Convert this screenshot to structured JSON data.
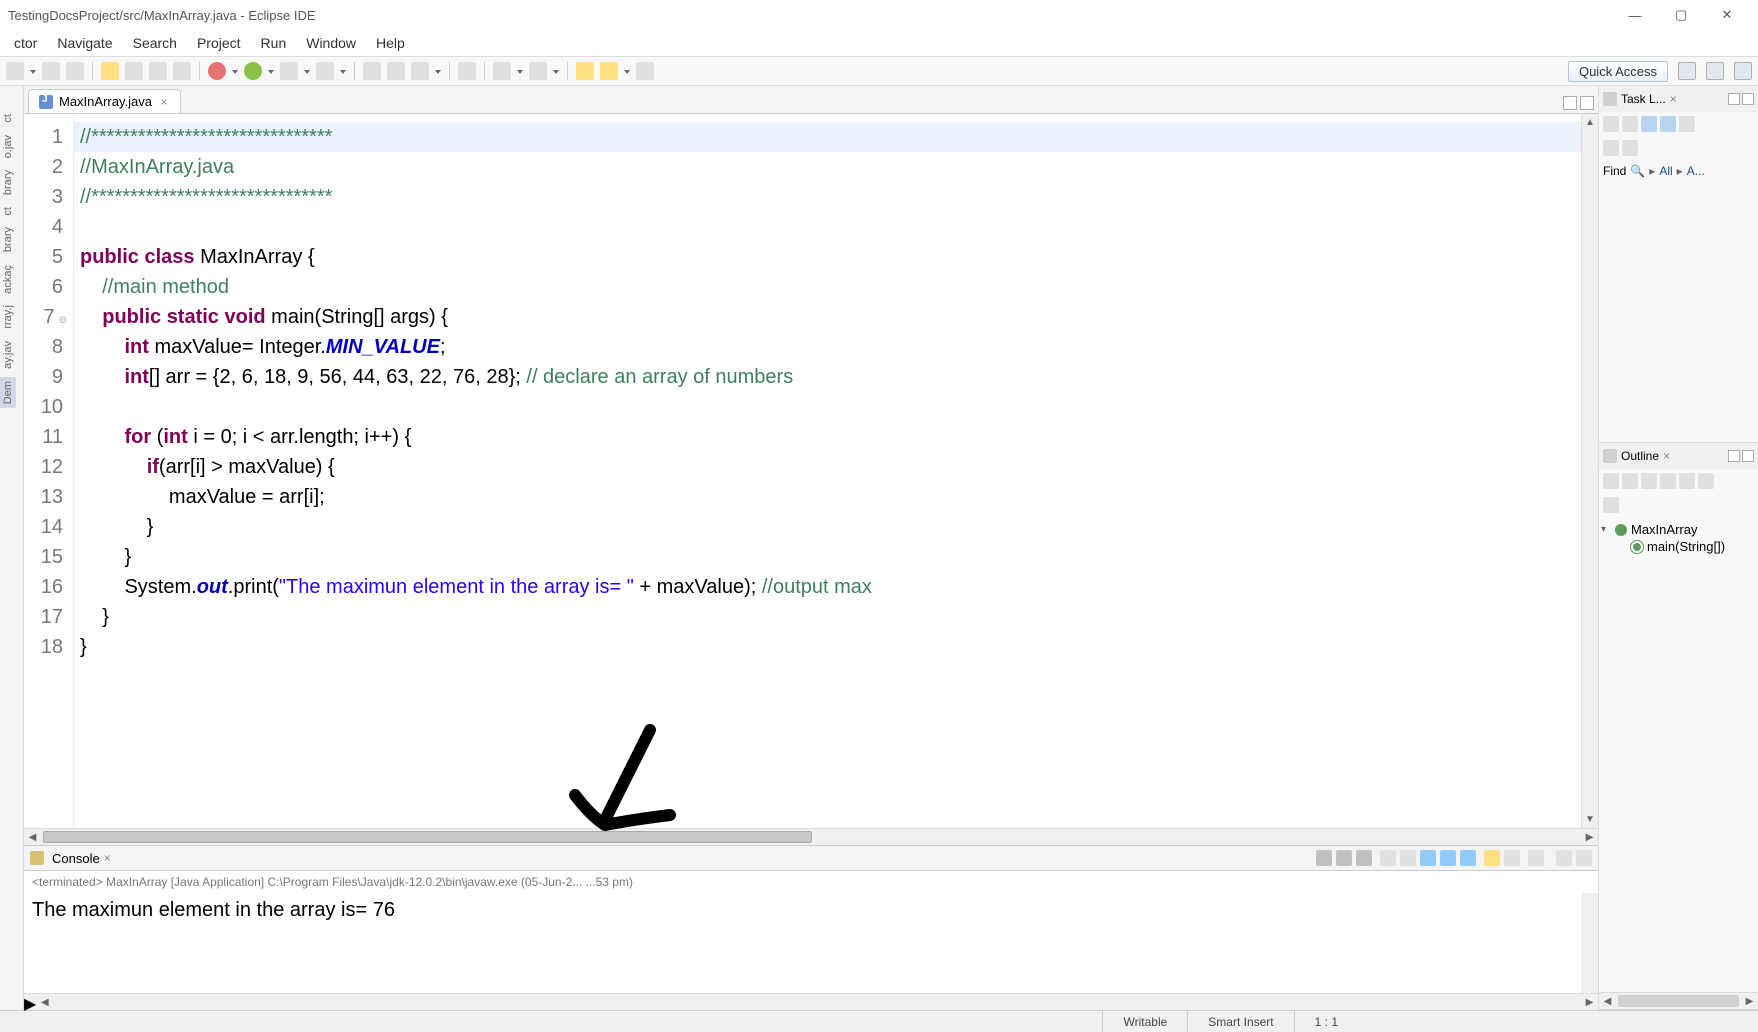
{
  "window": {
    "title": "TestingDocsProject/src/MaxInArray.java - Eclipse IDE"
  },
  "menu": [
    "ctor",
    "Navigate",
    "Search",
    "Project",
    "Run",
    "Window",
    "Help"
  ],
  "quick_access": "Quick Access",
  "left_panel_items": [
    {
      "label": "ct",
      "sel": false
    },
    {
      "label": "o.jav",
      "sel": false
    },
    {
      "label": "brary",
      "sel": false
    },
    {
      "label": "ct",
      "sel": false
    },
    {
      "label": "brary",
      "sel": false
    },
    {
      "label": "ackaç",
      "sel": false
    },
    {
      "label": "rray.j",
      "sel": false
    },
    {
      "label": "ay.jav",
      "sel": false
    },
    {
      "label": "Dem",
      "sel": true
    }
  ],
  "editor_tab": {
    "filename": "MaxInArray.java"
  },
  "code": {
    "lines": [
      {
        "n": "1",
        "hl": true,
        "html": "<span class='cm'>//*******************************</span>"
      },
      {
        "n": "2",
        "hl": false,
        "html": "<span class='cm'>//MaxInArray.java</span>"
      },
      {
        "n": "3",
        "hl": false,
        "html": "<span class='cm'>//*******************************</span>"
      },
      {
        "n": "4",
        "hl": false,
        "html": ""
      },
      {
        "n": "5",
        "hl": false,
        "html": "<span class='kw'>public</span> <span class='kw'>class</span> MaxInArray {"
      },
      {
        "n": "6",
        "hl": false,
        "html": "    <span class='cm'>//main method</span>"
      },
      {
        "n": "7",
        "hl": false,
        "mk": true,
        "html": "    <span class='kw'>public</span> <span class='kw'>static</span> <span class='kw'>void</span> main(String[] args) {"
      },
      {
        "n": "8",
        "hl": false,
        "html": "        <span class='kw'>int</span> maxValue= Integer.<span class='fd'>MIN_VALUE</span>;"
      },
      {
        "n": "9",
        "hl": false,
        "html": "        <span class='kw'>int</span>[] arr = {2, 6, 18, 9, 56, 44, 63, 22, 76, 28}; <span class='cm'>// declare an array of numbers</span>"
      },
      {
        "n": "10",
        "hl": false,
        "html": ""
      },
      {
        "n": "11",
        "hl": false,
        "html": "        <span class='kw'>for</span> (<span class='kw'>int</span> i = 0; i &lt; arr.length; i++) {"
      },
      {
        "n": "12",
        "hl": false,
        "html": "            <span class='kw'>if</span>(arr[i] &gt; maxValue) {"
      },
      {
        "n": "13",
        "hl": false,
        "html": "                maxValue = arr[i];"
      },
      {
        "n": "14",
        "hl": false,
        "html": "            }"
      },
      {
        "n": "15",
        "hl": false,
        "html": "        }"
      },
      {
        "n": "16",
        "hl": false,
        "html": "        System.<span class='fd'>out</span>.print(<span class='st'>\"The maximun element in the array is= \"</span> + maxValue); <span class='cm'>//output max</span>"
      },
      {
        "n": "17",
        "hl": false,
        "html": "    }"
      },
      {
        "n": "18",
        "hl": false,
        "html": "}"
      }
    ]
  },
  "console": {
    "title": "Console",
    "meta": "<terminated> MaxInArray [Java Application] C:\\Program Files\\Java\\jdk-12.0.2\\bin\\javaw.exe (05-Jun-2...      ...53 pm)",
    "output": "The maximun element in the array is= 76"
  },
  "tasklist": {
    "title": "Task L...",
    "find_label": "Find",
    "all_link": "All",
    "a_link": "A..."
  },
  "outline": {
    "title": "Outline",
    "class_name": "MaxInArray",
    "method_name": "main(String[])"
  },
  "status": {
    "writable": "Writable",
    "insert": "Smart Insert",
    "position": "1 : 1"
  }
}
